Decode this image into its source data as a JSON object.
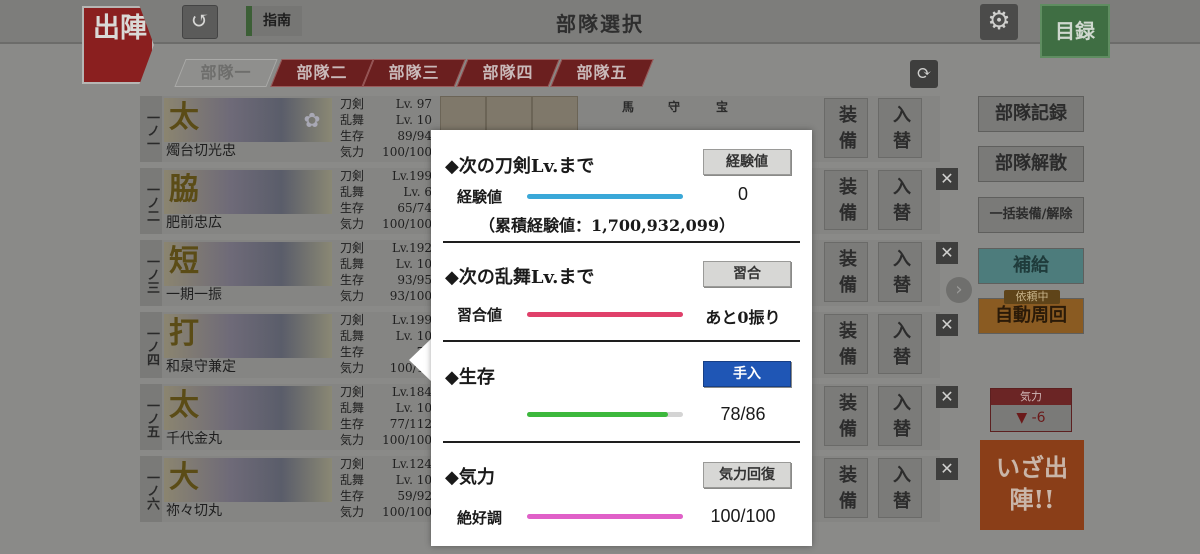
{
  "header": {
    "sortie_label": "出陣",
    "back_icon": "↺",
    "guide_label": "指南",
    "title": "部隊選択",
    "settings_icon": "⚙",
    "catalog_label": "目録"
  },
  "tabs": [
    "部隊一",
    "部隊二",
    "部隊三",
    "部隊四",
    "部隊五"
  ],
  "slot_labels": [
    "馬",
    "守",
    "宝"
  ],
  "units": [
    {
      "num": "一ノ一",
      "type": "太",
      "name": "燭台切光忠",
      "stat_labels": [
        "刀剣",
        "乱舞",
        "生存",
        "気力"
      ],
      "stats": [
        "Lv. 97",
        "Lv. 10",
        "89/94",
        "100/100"
      ]
    },
    {
      "num": "一ノ二",
      "type": "脇",
      "name": "肥前忠広",
      "stat_labels": [
        "刀剣",
        "乱舞",
        "生存",
        "気力"
      ],
      "stats": [
        "Lv.199",
        "Lv. 6",
        "65/74",
        "100/100"
      ]
    },
    {
      "num": "一ノ三",
      "type": "短",
      "name": "一期一振",
      "stat_labels": [
        "刀剣",
        "乱舞",
        "生存",
        "気力"
      ],
      "stats": [
        "Lv.192",
        "Lv. 10",
        "93/95",
        "93/100"
      ]
    },
    {
      "num": "一ノ四",
      "type": "打",
      "name": "和泉守兼定",
      "stat_labels": [
        "刀剣",
        "乱舞",
        "生存",
        "気力"
      ],
      "stats": [
        "Lv.199",
        "Lv. 10",
        "78",
        "100/10"
      ]
    },
    {
      "num": "一ノ五",
      "type": "太",
      "name": "千代金丸",
      "stat_labels": [
        "刀剣",
        "乱舞",
        "生存",
        "気力"
      ],
      "stats": [
        "Lv.184",
        "Lv. 10",
        "77/112",
        "100/100"
      ]
    },
    {
      "num": "一ノ六",
      "type": "大",
      "name": "祢々切丸",
      "stat_labels": [
        "刀剣",
        "乱舞",
        "生存",
        "気力"
      ],
      "stats": [
        "Lv.124",
        "Lv. 10",
        "59/92",
        "100/100"
      ]
    }
  ],
  "row_buttons": {
    "equip": "装備",
    "swap": "入替",
    "remove_icon": "✕"
  },
  "side": {
    "record": "部隊記録",
    "disband": "部隊解散",
    "bulk_equip": "一括装備/解除",
    "supply": "補給",
    "request_badge": "依頼中",
    "auto_loop": "自動周回",
    "morale_head": "気力",
    "morale_value": "▼ -6",
    "go": "いざ出陣!!",
    "next_icon": "›",
    "sync_icon": "⟳"
  },
  "popup": {
    "exp": {
      "title": "◆次の刀剣Lv.まで",
      "button": "経験値",
      "row_label": "経験値",
      "value": "0",
      "fill": 1.0,
      "cumulative": "（累積経験値：1,700,932,099）"
    },
    "ranbu": {
      "title": "◆次の乱舞Lv.まで",
      "button": "習合",
      "row_label": "習合値",
      "value": "あと0振り",
      "fill": 1.0
    },
    "hp": {
      "title": "◆生存",
      "button": "手入",
      "value": "78/86",
      "fill": 0.907
    },
    "morale": {
      "title": "◆気力",
      "button": "気力回復",
      "row_label": "絶好調",
      "value": "100/100",
      "fill": 1.0
    }
  },
  "colors": {
    "exp_bar": "#3aa8d8",
    "ranbu_bar": "#e0406a",
    "hp_bar": "#3cb83c",
    "morale_bar": "#e060c8",
    "repair_button": "#1f56b5"
  }
}
